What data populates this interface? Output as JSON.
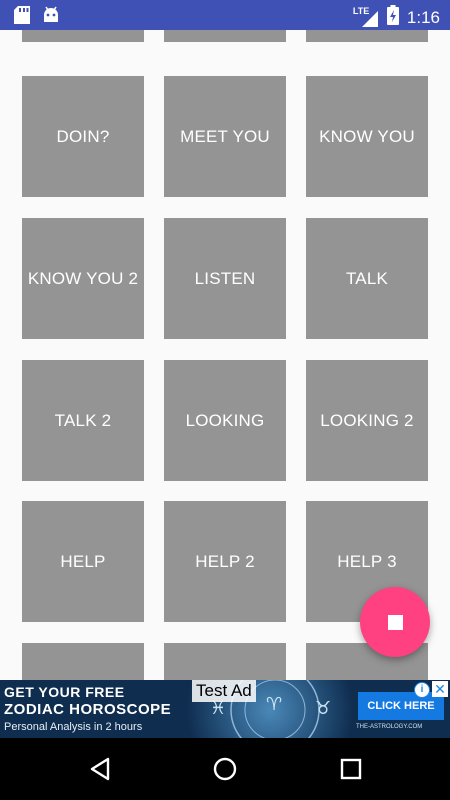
{
  "status_bar": {
    "time": "1:16",
    "network": "LTE",
    "icons": [
      "sd-card-icon",
      "android-icon",
      "lte-signal-icon",
      "battery-charging-icon"
    ]
  },
  "tiles": [
    {
      "label": ""
    },
    {
      "label": ""
    },
    {
      "label": ""
    },
    {
      "label": "DOIN?"
    },
    {
      "label": "MEET YOU"
    },
    {
      "label": "KNOW YOU"
    },
    {
      "label": "KNOW YOU 2"
    },
    {
      "label": "LISTEN"
    },
    {
      "label": "TALK"
    },
    {
      "label": "TALK 2"
    },
    {
      "label": "LOOKING"
    },
    {
      "label": "LOOKING 2"
    },
    {
      "label": "HELP"
    },
    {
      "label": "HELP 2"
    },
    {
      "label": "HELP 3"
    },
    {
      "label": ""
    },
    {
      "label": ""
    },
    {
      "label": ""
    }
  ],
  "fab": {
    "icon": "stop-icon",
    "color": "#ff4081"
  },
  "ad": {
    "test_label": "Test Ad",
    "line1": "GET YOUR FREE",
    "line2": "ZODIAC HOROSCOPE",
    "line3": "Personal Analysis in 2 hours",
    "cta": "CLICK HERE",
    "domain": "THE-ASTROLOGY.COM",
    "info_icon": "info-icon",
    "close_icon": "close-icon"
  },
  "nav_bar": {
    "icons": [
      "back-icon",
      "home-icon",
      "recents-icon"
    ]
  },
  "colors": {
    "status_bar": "#3f51b5",
    "tile": "#949494",
    "fab": "#ff4081",
    "background": "#fafafa"
  }
}
